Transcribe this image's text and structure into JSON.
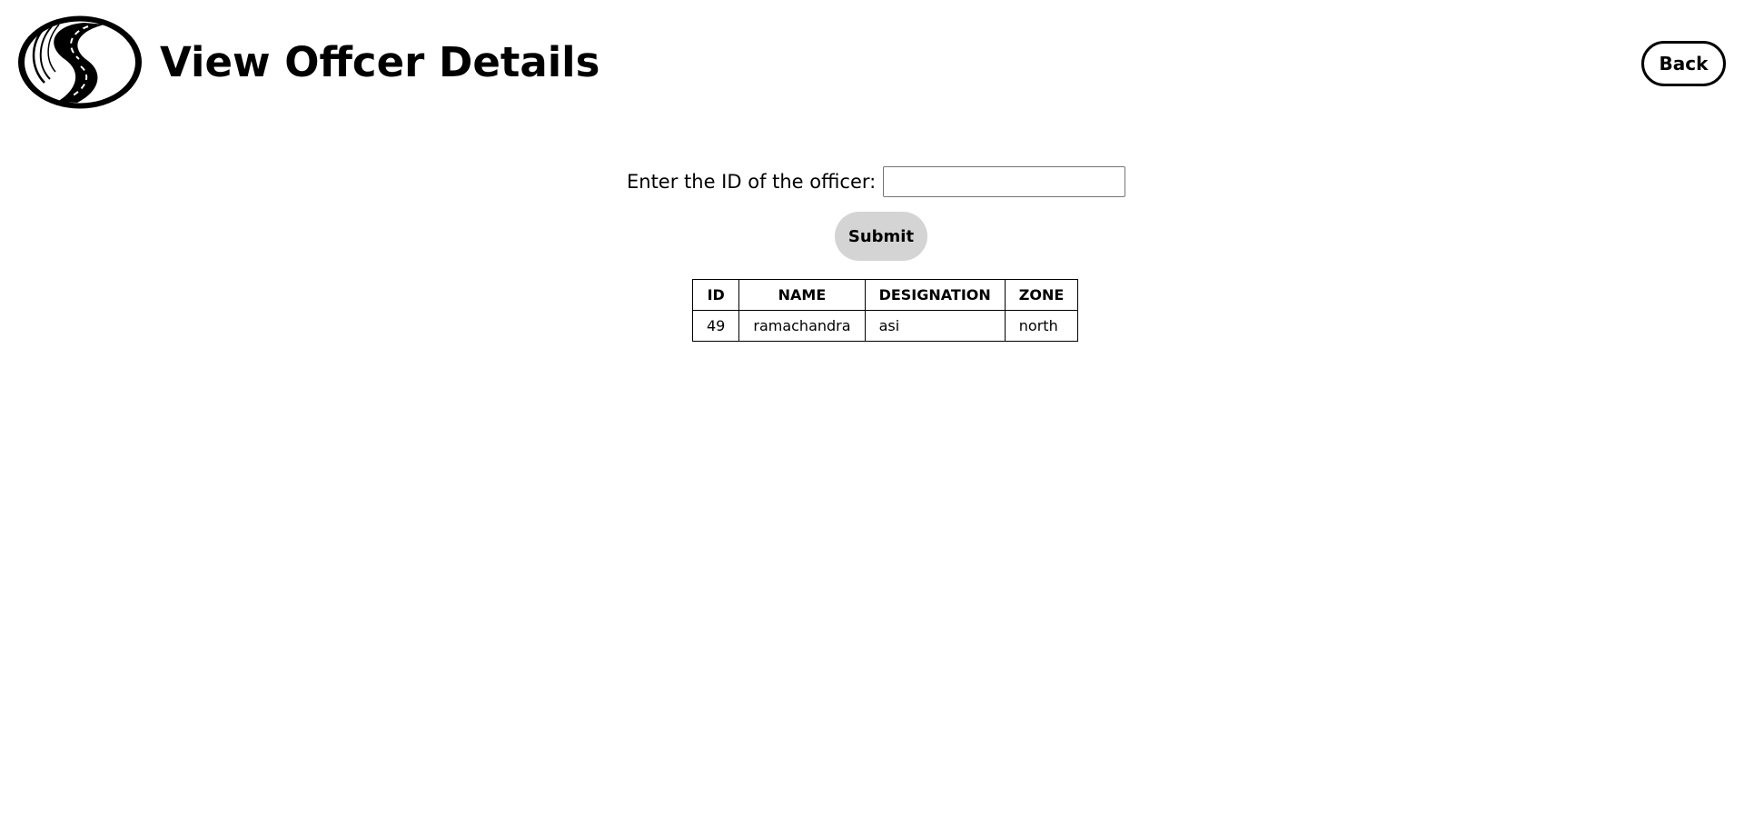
{
  "header": {
    "title": "View Offcer Details",
    "logo_icon": "winding-road-logo-icon",
    "back_label": "Back"
  },
  "form": {
    "label": "Enter the ID of the officer:",
    "input_value": "",
    "input_placeholder": "",
    "submit_label": "Submit"
  },
  "table": {
    "columns": [
      "ID",
      "NAME",
      "DESIGNATION",
      "ZONE"
    ],
    "rows": [
      [
        "49",
        "ramachandra",
        "asi",
        "north"
      ]
    ]
  },
  "colors": {
    "submit_background": "#d4d4d4",
    "text": "#000000",
    "background": "#ffffff"
  }
}
